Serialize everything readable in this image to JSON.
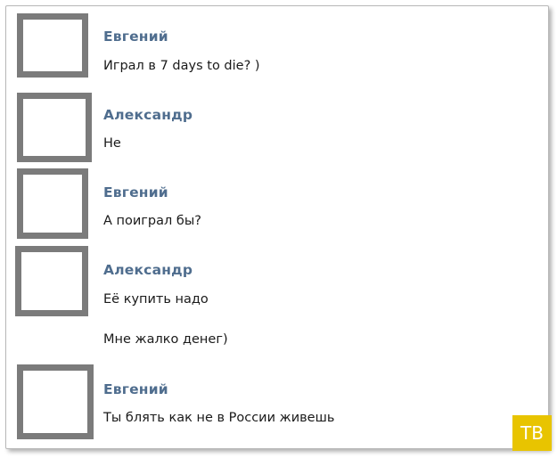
{
  "messages": [
    {
      "author": "Евгений",
      "lines": [
        "Играл в 7 days to die? )"
      ]
    },
    {
      "author": "Александр",
      "lines": [
        "Не"
      ]
    },
    {
      "author": "Евгений",
      "lines": [
        "А поиграл бы?"
      ]
    },
    {
      "author": "Александр",
      "lines": [
        "Её купить надо",
        "Мне жалко денег)"
      ]
    },
    {
      "author": "Евгений",
      "lines": [
        "Ты блять как не в России живешь"
      ]
    }
  ],
  "watermark": {
    "text": "ТВ",
    "color": "#e8c400"
  },
  "colors": {
    "author_name": "#4f6d8e",
    "avatar_border": "#7b7b7b",
    "message_text": "#1a1a1a"
  }
}
